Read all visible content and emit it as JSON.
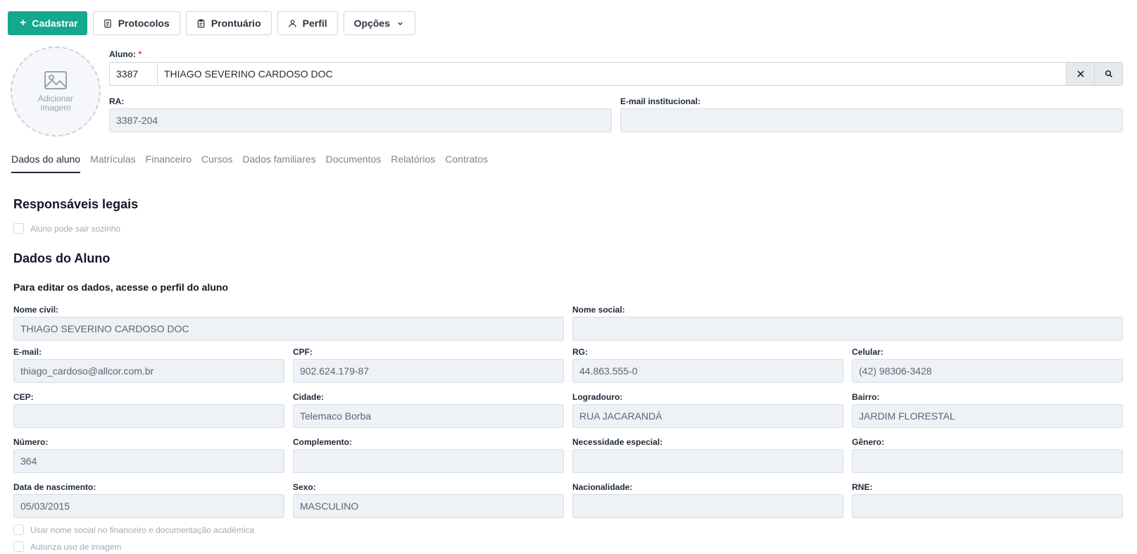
{
  "toolbar": {
    "cadastrar": "Cadastrar",
    "protocolos": "Protocolos",
    "prontuario": "Prontuário",
    "perfil": "Perfil",
    "opcoes": "Opções"
  },
  "avatar": {
    "line1": "Adicionar",
    "line2": "imagem"
  },
  "aluno": {
    "label": "Aluno:",
    "required_mark": "*",
    "code": "3387",
    "name": "THIAGO SEVERINO CARDOSO DOC"
  },
  "ra": {
    "label": "RA:",
    "value": "3387-204"
  },
  "email_inst": {
    "label": "E-mail institucional:",
    "value": ""
  },
  "tabs": [
    "Dados do aluno",
    "Matrículas",
    "Financeiro",
    "Cursos",
    "Dados familiares",
    "Documentos",
    "Relatórios",
    "Contratos"
  ],
  "responsaveis": {
    "title": "Responsáveis legais",
    "checkbox": "Aluno pode sair sozinho"
  },
  "dados": {
    "title": "Dados do Aluno",
    "subtitle": "Para editar os dados, acesse o perfil do aluno"
  },
  "fields": {
    "nome_civil": {
      "label": "Nome civil:",
      "value": "THIAGO SEVERINO CARDOSO DOC"
    },
    "nome_social": {
      "label": "Nome social:",
      "value": ""
    },
    "email": {
      "label": "E-mail:",
      "value": "thiago_cardoso@allcor.com.br"
    },
    "cpf": {
      "label": "CPF:",
      "value": "902.624.179-87"
    },
    "rg": {
      "label": "RG:",
      "value": "44.863.555-0"
    },
    "celular": {
      "label": "Celular:",
      "value": "(42) 98306-3428"
    },
    "cep": {
      "label": "CEP:",
      "value": ""
    },
    "cidade": {
      "label": "Cidade:",
      "value": "Telemaco Borba"
    },
    "logradouro": {
      "label": "Logradouro:",
      "value": "RUA JACARANDÁ"
    },
    "bairro": {
      "label": "Bairro:",
      "value": "JARDIM FLORESTAL"
    },
    "numero": {
      "label": "Número:",
      "value": "364"
    },
    "complemento": {
      "label": "Complemento:",
      "value": ""
    },
    "necessidade": {
      "label": "Necessidade especial:",
      "value": ""
    },
    "genero": {
      "label": "Gênero:",
      "value": ""
    },
    "nascimento": {
      "label": "Data de nascimento:",
      "value": "05/03/2015"
    },
    "sexo": {
      "label": "Sexo:",
      "value": "MASCULINO"
    },
    "nacionalidade": {
      "label": "Nacionalidade:",
      "value": ""
    },
    "rne": {
      "label": "RNE:",
      "value": ""
    }
  },
  "checks": {
    "nome_social_fin": "Usar nome social no financeiro e documentação acadêmica",
    "uso_imagem": "Autoriza uso de imagem"
  },
  "colors": {
    "primary": "#14a88e",
    "field_bg": "#eef1f6",
    "required": "#e53935"
  }
}
